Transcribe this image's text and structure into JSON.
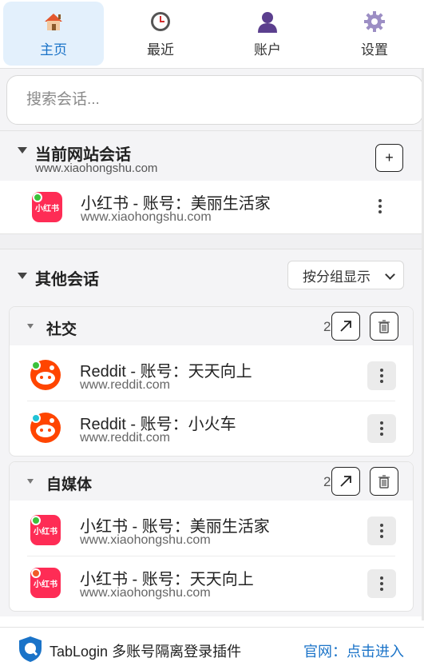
{
  "nav": {
    "items": [
      {
        "label": "主页",
        "icon": "home-icon",
        "active": true
      },
      {
        "label": "最近",
        "icon": "clock-icon",
        "active": false
      },
      {
        "label": "账户",
        "icon": "user-icon",
        "active": false
      },
      {
        "label": "设置",
        "icon": "gear-icon",
        "active": false
      }
    ]
  },
  "search": {
    "placeholder": "搜索会话..."
  },
  "current": {
    "title": "当前网站会话",
    "domain": "www.xiaohongshu.com",
    "add_label": "+",
    "session": {
      "title": "小红书 - 账号：美丽生活家",
      "url": "www.xiaohongshu.com",
      "status_color": "#3cc13b"
    }
  },
  "other": {
    "title": "其他会话",
    "group_mode": "按分组显示",
    "groups": [
      {
        "name": "社交",
        "count": "2",
        "sessions": [
          {
            "title": "Reddit - 账号：天天向上",
            "url": "www.reddit.com",
            "status_color": "#3cc13b",
            "icon": "reddit-icon"
          },
          {
            "title": "Reddit - 账号：小火车",
            "url": "www.reddit.com",
            "status_color": "#22c3d6",
            "icon": "reddit-icon"
          }
        ]
      },
      {
        "name": "自媒体",
        "count": "2",
        "sessions": [
          {
            "title": "小红书 - 账号：美丽生活家",
            "url": "www.xiaohongshu.com",
            "status_color": "#3cc13b",
            "icon": "xiaohongshu-icon"
          },
          {
            "title": "小红书 - 账号：天天向上",
            "url": "www.xiaohongshu.com",
            "status_color": "#f05a28",
            "icon": "xiaohongshu-icon"
          }
        ]
      }
    ]
  },
  "footer": {
    "title": "TabLogin 多账号隔离登录插件",
    "link": "官网：点击进入"
  },
  "colors": {
    "accent": "#1a73c8",
    "active_nav_bg": "#e3f0fc",
    "xhs_red": "#fe2c55",
    "reddit_orange": "#ff4500"
  }
}
